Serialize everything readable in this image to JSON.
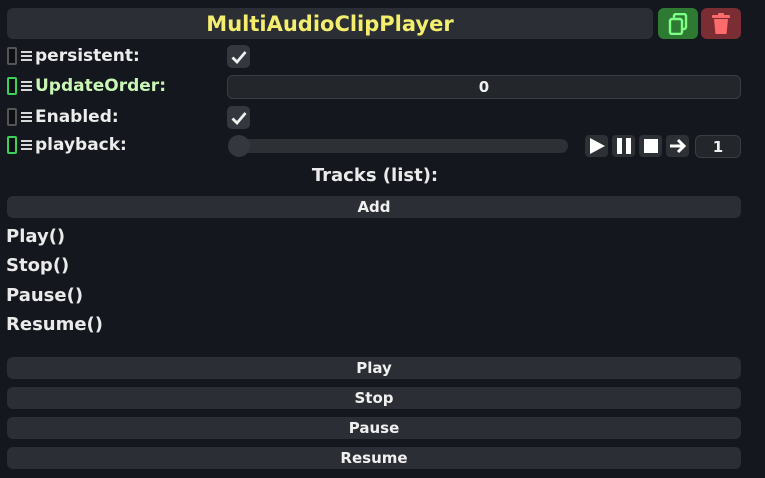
{
  "header": {
    "title": "MultiAudioClipPlayer",
    "duplicate_icon": "copy-icon",
    "delete_icon": "trash-icon",
    "colors": {
      "title": "#f3ee6e",
      "duplicate_bg": "#2f7a33",
      "delete_bg": "#7a2d33"
    }
  },
  "properties": {
    "persistent": {
      "label": "persistent:",
      "checked": true
    },
    "update_order": {
      "label": "UpdateOrder:",
      "value": "0"
    },
    "enabled": {
      "label": "Enabled:",
      "checked": true
    },
    "playback": {
      "label": "playback:",
      "value": "1",
      "progress": 0
    }
  },
  "tracks": {
    "title": "Tracks (list):",
    "add_label": "Add"
  },
  "methods": [
    "Play()",
    "Stop()",
    "Pause()",
    "Resume()"
  ],
  "buttons": {
    "play": "Play",
    "stop": "Stop",
    "pause": "Pause",
    "resume": "Resume"
  }
}
